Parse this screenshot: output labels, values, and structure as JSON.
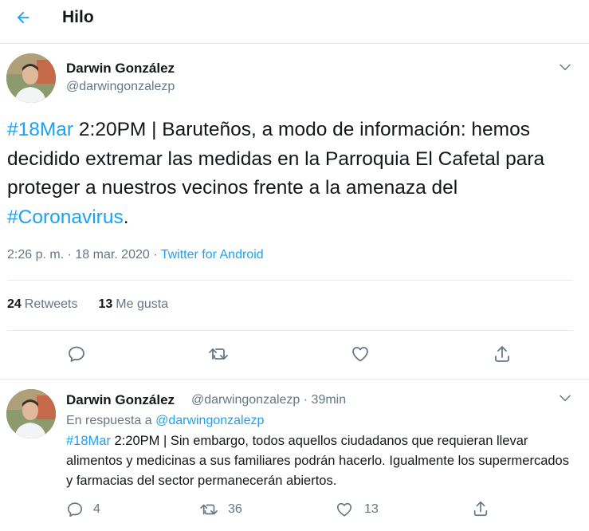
{
  "header": {
    "title": "Hilo"
  },
  "main_tweet": {
    "author_name": "Darwin González",
    "author_handle": "@darwingonzalezp",
    "text_hashtag_1": "#18Mar",
    "text_body_1": " 2:20PM | Baruteños, a modo de información: hemos decidido extremar las medidas en la Parroquia El Cafetal para proteger a nuestros vecinos frente a la amenaza del ",
    "text_hashtag_2": "#Coronavirus",
    "text_body_2": ".",
    "timestamp": "2:26 p. m. · 18 mar. 2020 · ",
    "source": "Twitter for Android",
    "retweets_count": "24",
    "retweets_label": "Retweets",
    "likes_count": "13",
    "likes_label": "Me gusta"
  },
  "reply_tweet": {
    "author_name": "Darwin González",
    "author_handle_time": "@darwingonzalezp · 39min",
    "reply_prefix": "En respuesta a ",
    "reply_to": "@darwingonzalezp",
    "text_hashtag": "#18Mar",
    "text_body": " 2:20PM | Sin embargo, todos aquellos ciudadanos que requieran llevar alimentos y medicinas a sus familiares podrán hacerlo. Igualmente los supermercados y farmacias del sector permanecerán abiertos.",
    "reply_count": "4",
    "retweet_count": "36",
    "like_count": "13"
  },
  "colors": {
    "accent": "#1da1f2",
    "secondary_text": "#657786",
    "primary_text": "#14171a",
    "divider": "#e6ecf0"
  },
  "icons": {
    "back": "arrow-left-icon",
    "more": "chevron-down-icon",
    "reply": "reply-icon",
    "retweet": "retweet-icon",
    "like": "heart-icon",
    "share": "share-icon"
  }
}
